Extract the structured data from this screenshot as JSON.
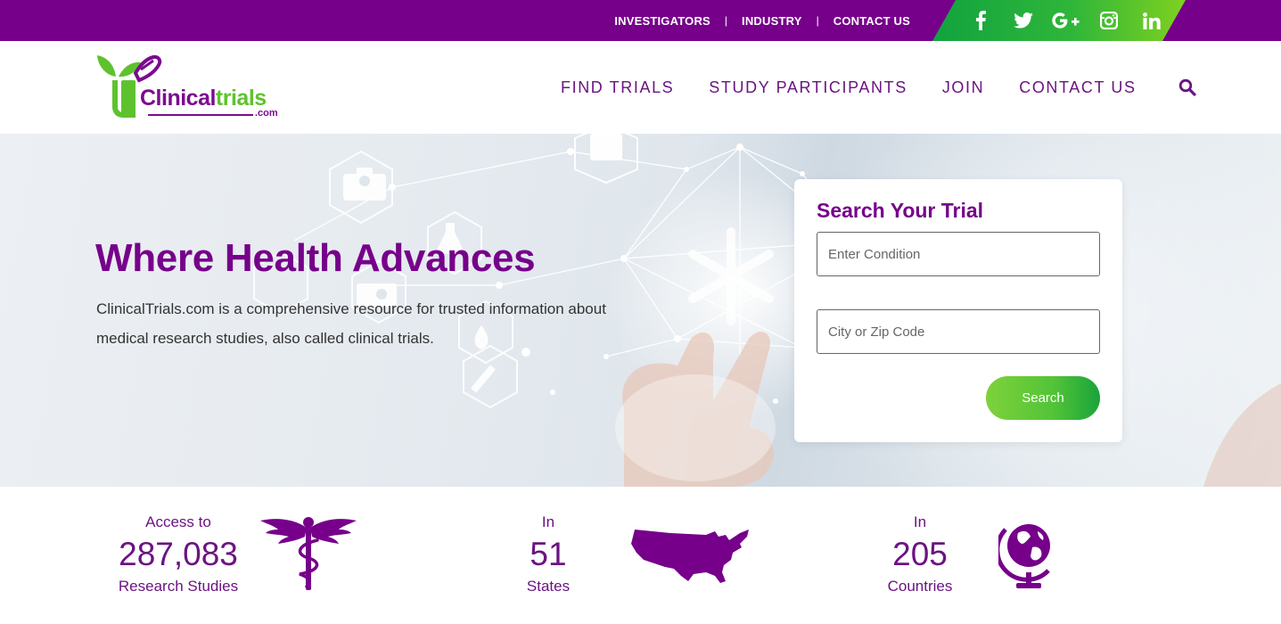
{
  "topbar": {
    "links": [
      "INVESTIGATORS",
      "INDUSTRY",
      "CONTACT US"
    ],
    "separator": "|",
    "social": [
      {
        "label": "f",
        "icon": "facebook-icon"
      },
      {
        "label": "",
        "icon": "twitter-icon"
      },
      {
        "label": "G+",
        "icon": "google-plus-icon"
      },
      {
        "label": "",
        "icon": "instagram-icon"
      },
      {
        "label": "in",
        "icon": "linkedin-icon"
      }
    ],
    "colors": {
      "bar": "#76008a",
      "social_start": "#12a33f",
      "social_end": "#7fd11f"
    }
  },
  "header": {
    "logo": {
      "word1": "Clinical",
      "word2": "trials",
      "suffix": ".com",
      "icon": "test-tube-leaf-logo-icon"
    },
    "nav": [
      "FIND TRIALS",
      "STUDY PARTICIPANTS",
      "JOIN",
      "CONTACT US"
    ],
    "search_icon": "magnifier-icon"
  },
  "hero": {
    "title": "Where Health Advances",
    "description": "ClinicalTrials.com is a comprehensive resource for trusted information about medical research studies, also called clinical trials.",
    "background": "medical network hand"
  },
  "search": {
    "title": "Search Your Trial",
    "condition_placeholder": "Enter Condition",
    "condition_value": "",
    "location_placeholder": "City or Zip Code",
    "location_value": "",
    "button_label": "Search"
  },
  "stats": [
    {
      "prefix": "Access to",
      "value": "287,083",
      "suffix": "Research Studies",
      "icon": "caduceus-icon"
    },
    {
      "prefix": "In",
      "value": "51",
      "suffix": "States",
      "icon": "usa-map-icon"
    },
    {
      "prefix": "In",
      "value": "205",
      "suffix": "Countries",
      "icon": "globe-icon"
    }
  ],
  "colors": {
    "brand_purple": "#76008a",
    "brand_green": "#5ec22f"
  }
}
